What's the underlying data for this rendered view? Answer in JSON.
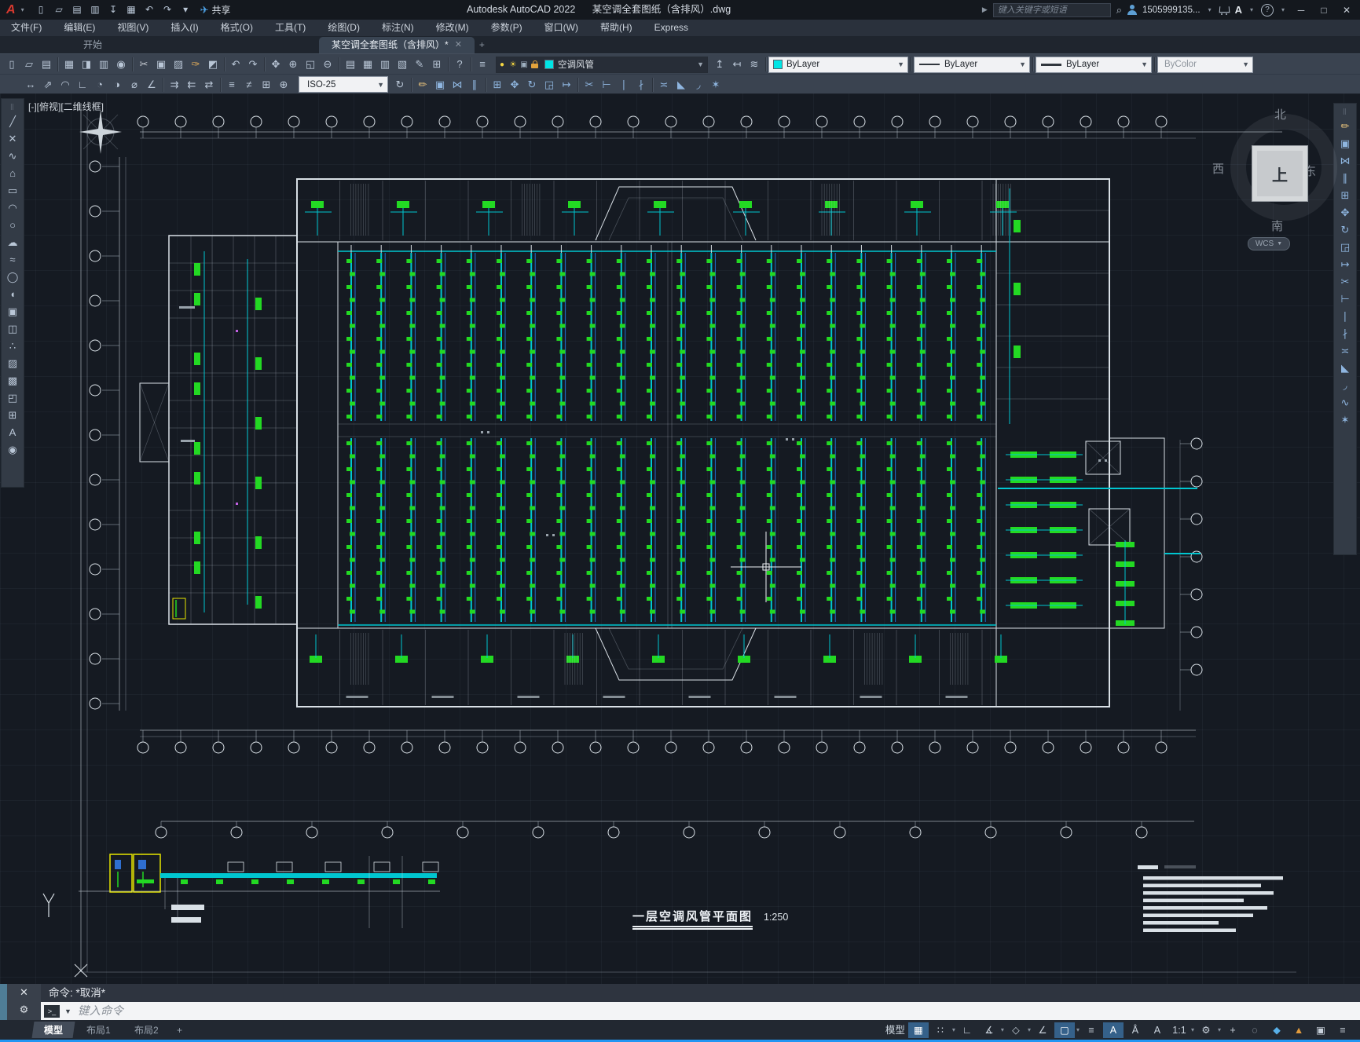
{
  "window": {
    "app_title": "Autodesk AutoCAD 2022",
    "doc_title": "某空调全套图纸（含排风）.dwg",
    "share_label": "共享",
    "search_placeholder": "键入关键字或短语",
    "username": "1505999135...",
    "minimize": "─",
    "maximize": "□",
    "close": "✕"
  },
  "menus": [
    "文件(F)",
    "编辑(E)",
    "视图(V)",
    "插入(I)",
    "格式(O)",
    "工具(T)",
    "绘图(D)",
    "标注(N)",
    "修改(M)",
    "参数(P)",
    "窗口(W)",
    "帮助(H)",
    "Express"
  ],
  "file_tabs": {
    "start": "开始",
    "doc": "某空调全套图纸（含排风）*",
    "close": "✕",
    "new": "+"
  },
  "toolbars": {
    "quick_access": [
      "new-file",
      "open",
      "save",
      "save-as",
      "export",
      "print",
      "undo",
      "redo",
      "customize-dropdown"
    ],
    "standard": [
      "new-file",
      "open",
      "save",
      "|",
      "plot",
      "plot-preview",
      "publish",
      "web-publish",
      "|",
      "cut",
      "copy",
      "paste",
      "match-properties",
      "block-editor",
      "|",
      "undo",
      "redo",
      "|",
      "pan",
      "zoom-realtime",
      "zoom-window",
      "zoom-previous",
      "|",
      "properties",
      "design-center",
      "tool-palettes",
      "sheet-set-manager",
      "markup",
      "quick-calc",
      "|",
      "help",
      "|",
      "layer-properties"
    ],
    "layer_tools": [
      "make-object-layer-current",
      "layer-previous",
      "layer-states"
    ],
    "dimension": [
      "linear-dimension",
      "aligned-dimension",
      "arc-length-dimension",
      "ordinate-dimension",
      "radius-dimension",
      "jogged-dimension",
      "diameter-dimension",
      "angular-dimension",
      "|",
      "quick-dimension",
      "baseline-dimension",
      "continue-dimension",
      "|",
      "dimension-space",
      "dimension-break",
      "tolerance",
      "center-mark"
    ],
    "dimension_update": [
      "dimension-update"
    ],
    "modify_row": [
      "erase",
      "copy",
      "mirror",
      "offset",
      "|",
      "array",
      "move",
      "rotate",
      "scale",
      "stretch",
      "|",
      "trim",
      "extend",
      "break-at-point",
      "break",
      "|",
      "join",
      "chamfer",
      "fillet",
      "explode"
    ],
    "draw_strip": [
      "line",
      "construction-line",
      "polyline",
      "polygon",
      "rectangle",
      "arc",
      "circle",
      "revision-cloud",
      "spline",
      "ellipse",
      "ellipse-arc",
      "insert-block",
      "create-block",
      "point",
      "hatch",
      "gradient",
      "region",
      "table",
      "multiline-text",
      "group"
    ],
    "modify_strip": [
      "erase",
      "copy",
      "mirror",
      "offset",
      "array",
      "move",
      "rotate",
      "scale",
      "stretch",
      "trim",
      "extend",
      "break-at-point",
      "break",
      "join",
      "chamfer",
      "fillet",
      "blend-curves",
      "explode"
    ],
    "layer_value": "空调风管",
    "color_value": "ByLayer",
    "linetype_value": "ByLayer",
    "lineweight_value": "ByLayer",
    "plotstyle_value": "ByColor",
    "dimstyle_value": "ISO-25"
  },
  "canvas": {
    "viewport_controls": "[-][俯视][二维线框]",
    "plan_title": "一层空调风管平面图",
    "plan_scale": "1:250",
    "wcs_label": "WCS",
    "compass": {
      "north": "北",
      "south": "南",
      "east": "东",
      "west": "西",
      "top": "上"
    }
  },
  "command": {
    "close": "✕",
    "history": "命令: *取消*",
    "prompt_glyph": ">_",
    "placeholder": "键入命令"
  },
  "statusbar": {
    "tabs": [
      {
        "label": "模型",
        "active": true
      },
      {
        "label": "布局1",
        "active": false
      },
      {
        "label": "布局2",
        "active": false
      }
    ],
    "new_layout": "+",
    "icons": [
      {
        "name": "model-space",
        "label": "模型"
      },
      {
        "name": "grid-display",
        "active": true
      },
      {
        "name": "snap-mode",
        "chevron": true
      },
      {
        "name": "ortho-mode"
      },
      {
        "name": "polar-tracking",
        "chevron": true
      },
      {
        "name": "isometric-drafting",
        "chevron": true
      },
      {
        "name": "object-snap-tracking"
      },
      {
        "name": "object-snap",
        "active": true,
        "chevron": true
      },
      {
        "name": "lineweight-display"
      },
      {
        "name": "annotation-visibility",
        "active": true
      },
      {
        "name": "annotation-autoscale"
      },
      {
        "name": "annotation-scale-sync"
      },
      {
        "name": "annotation-scale",
        "label": "1:1",
        "chevron": true
      },
      {
        "name": "workspace-switching",
        "chevron": true
      },
      {
        "name": "crosshair"
      },
      {
        "name": "isolate-objects"
      },
      {
        "name": "hardware-acceleration",
        "color": "#58b0e8"
      },
      {
        "name": "performance-monitor",
        "color": "#e09a3c"
      },
      {
        "name": "clean-screen"
      },
      {
        "name": "customization"
      }
    ]
  },
  "colors": {
    "titlebar": "#14181e",
    "ribbon": "#3a4350",
    "canvas_bg": "#151a22",
    "accent_bottom": "#2196f3",
    "layer_swatch_cyan": "#00e5e5",
    "duct_cyan": "#00c6d0",
    "diffuser_green": "#23d923",
    "wall_white": "#d9e0e6",
    "highlight_yellow": "#e6e600"
  }
}
